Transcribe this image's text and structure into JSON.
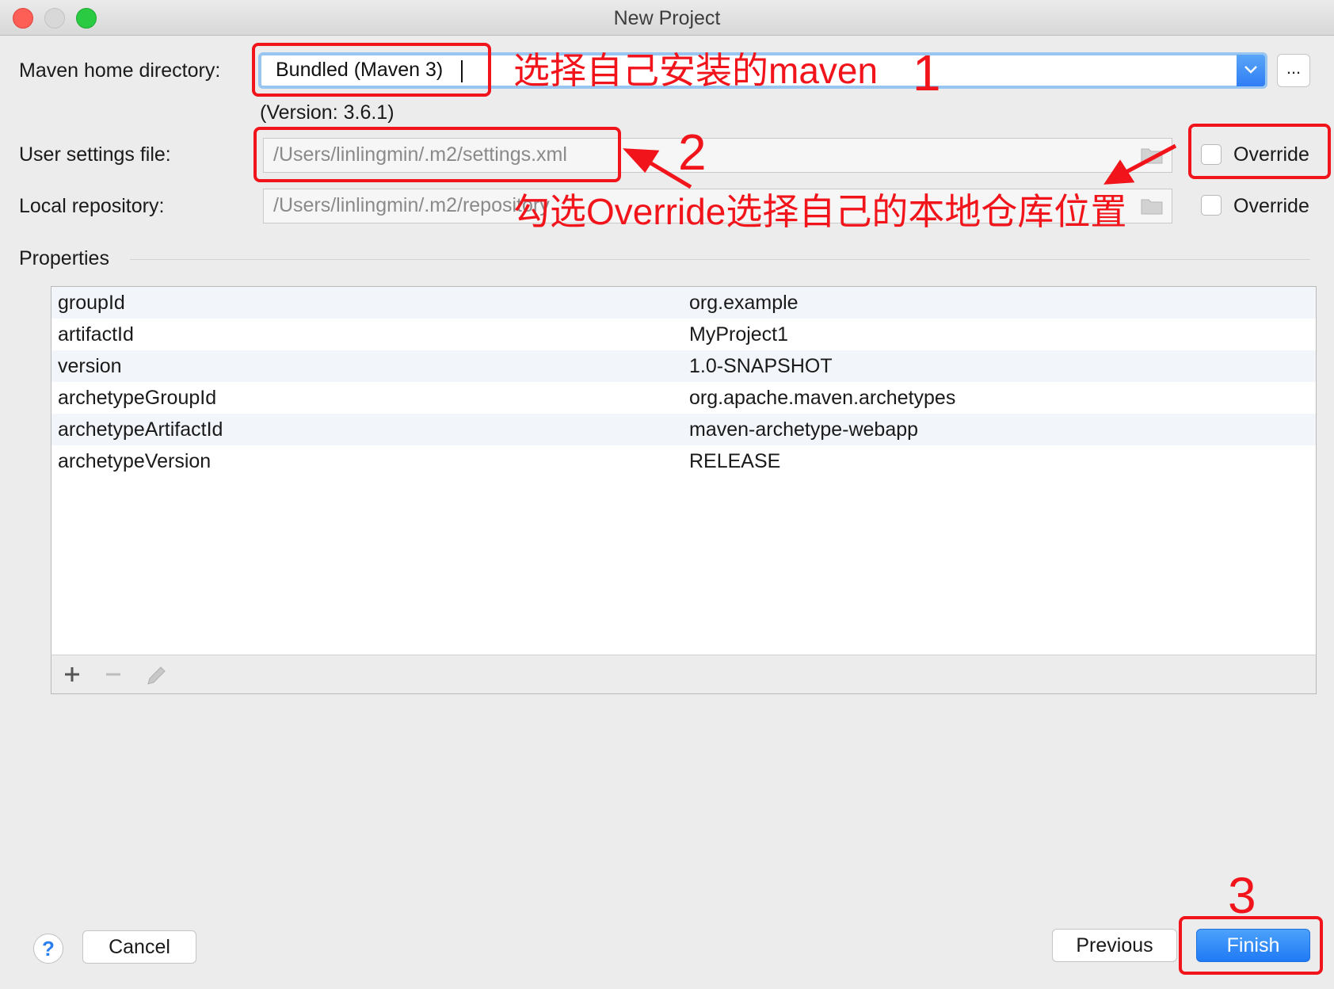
{
  "window": {
    "title": "New Project"
  },
  "maven_home": {
    "label": "Maven home directory:",
    "value": "Bundled (Maven 3)",
    "browse_label": "...",
    "version": "(Version: 3.6.1)"
  },
  "user_settings": {
    "label": "User settings file:",
    "value": "/Users/linlingmin/.m2/settings.xml",
    "override_label": "Override",
    "override_checked": false
  },
  "local_repo": {
    "label": "Local repository:",
    "value": "/Users/linlingmin/.m2/repository",
    "override_label": "Override",
    "override_checked": false
  },
  "properties": {
    "title": "Properties",
    "rows": [
      {
        "key": "groupId",
        "value": "org.example"
      },
      {
        "key": "artifactId",
        "value": "MyProject1"
      },
      {
        "key": "version",
        "value": "1.0-SNAPSHOT"
      },
      {
        "key": "archetypeGroupId",
        "value": "org.apache.maven.archetypes"
      },
      {
        "key": "archetypeArtifactId",
        "value": "maven-archetype-webapp"
      },
      {
        "key": "archetypeVersion",
        "value": "RELEASE"
      }
    ],
    "toolbar": [
      "plus-icon",
      "minus-icon",
      "edit-icon"
    ]
  },
  "buttons": {
    "help": "?",
    "cancel": "Cancel",
    "previous": "Previous",
    "finish": "Finish"
  },
  "annotations": {
    "note1": "选择自己安装的maven",
    "num1": "1",
    "num2": "2",
    "note2": "勾选Override选择自己的本地仓库位置",
    "num3": "3",
    "color": "#f2141b"
  },
  "colors": {
    "accent": "#2f7ef5",
    "window_bg": "#ececec"
  }
}
